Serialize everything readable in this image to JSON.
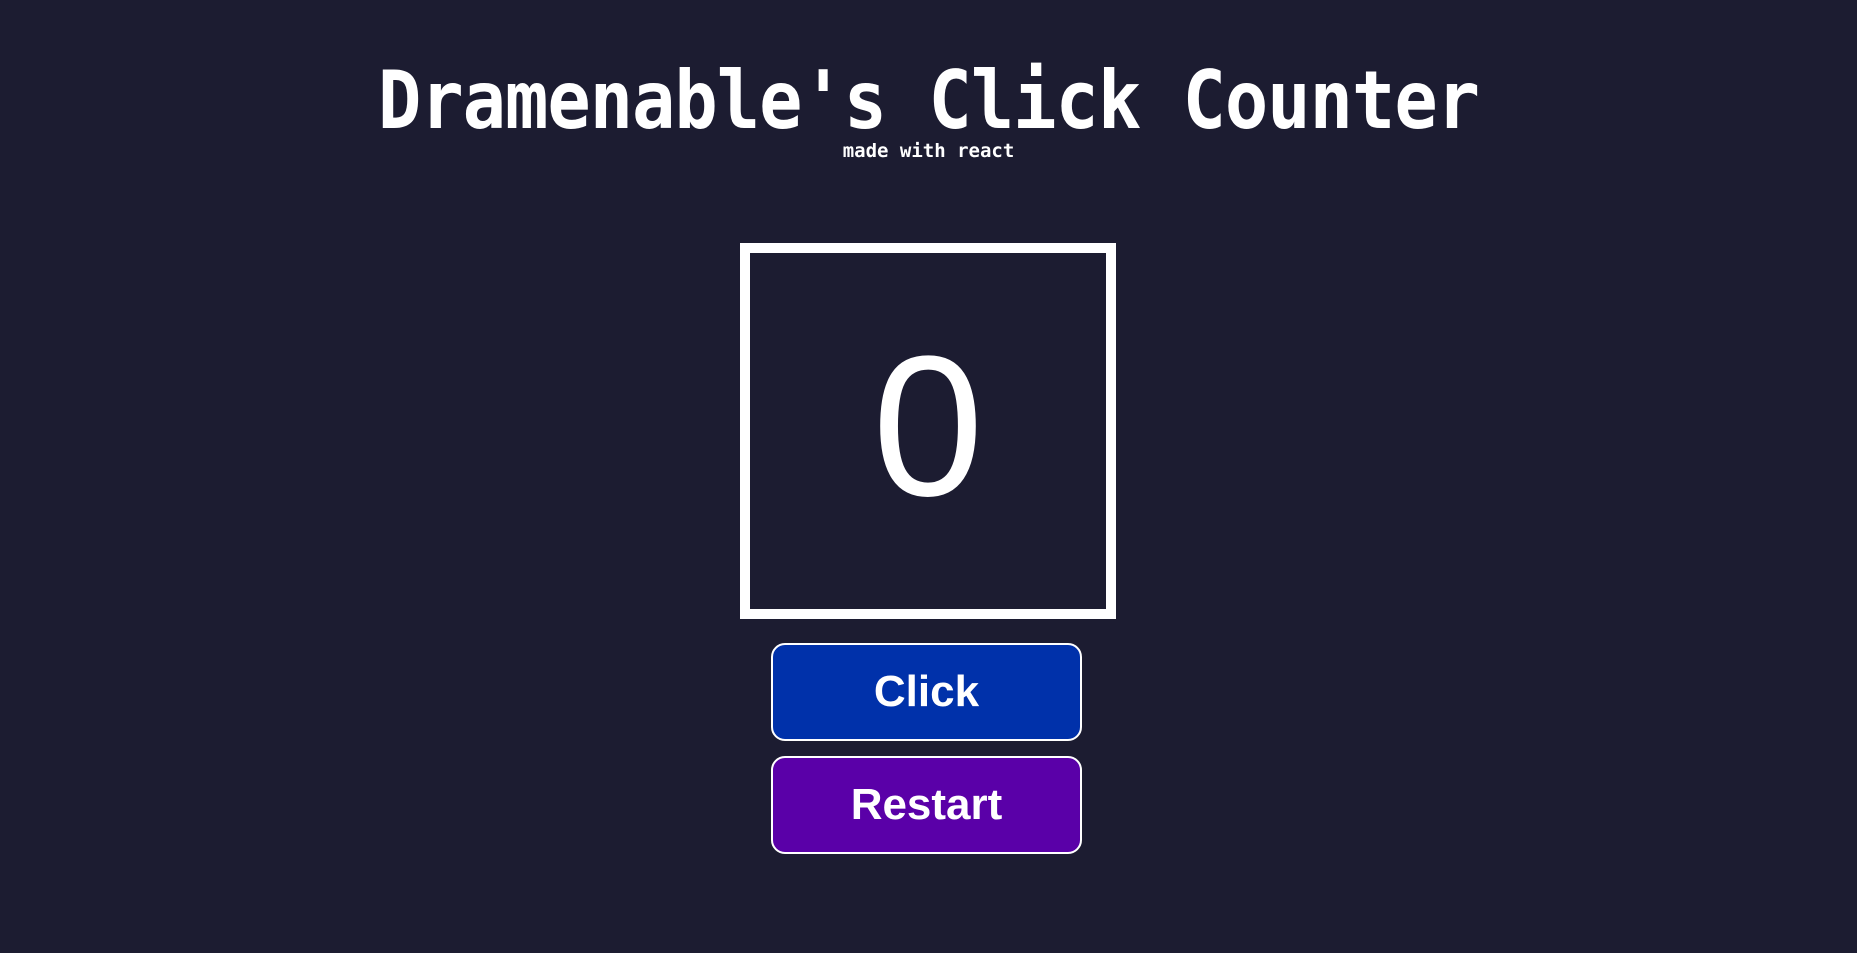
{
  "header": {
    "title": "Dramenable's Click Counter",
    "subtitle": "made with react"
  },
  "counter": {
    "value": "0"
  },
  "buttons": {
    "click_label": "Click",
    "restart_label": "Restart"
  },
  "colors": {
    "background": "#1c1c31",
    "click_button": "#0031aa",
    "restart_button": "#5a00a8",
    "foreground": "#ffffff"
  }
}
